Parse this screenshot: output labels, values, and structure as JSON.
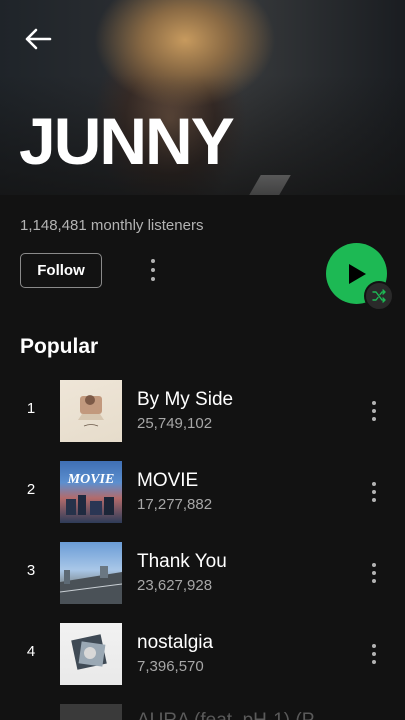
{
  "artist": {
    "name": "JUNNY",
    "monthly_listeners": "1,148,481 monthly listeners"
  },
  "actions": {
    "follow_label": "Follow"
  },
  "section": {
    "title": "Popular"
  },
  "tracks": [
    {
      "rank": "1",
      "title": "By My Side",
      "plays": "25,749,102"
    },
    {
      "rank": "2",
      "title": "MOVIE",
      "plays": "17,277,882"
    },
    {
      "rank": "3",
      "title": "Thank You",
      "plays": "23,627,928"
    },
    {
      "rank": "4",
      "title": "nostalgia",
      "plays": "7,396,570"
    }
  ],
  "partial_track": {
    "title": "AURA (feat. pH-1) (P"
  },
  "colors": {
    "accent": "#1db954",
    "background": "#121212",
    "secondary_text": "#b3b3b3"
  },
  "icons": [
    "back-arrow-icon",
    "more-vertical-icon",
    "play-icon",
    "shuffle-icon"
  ]
}
